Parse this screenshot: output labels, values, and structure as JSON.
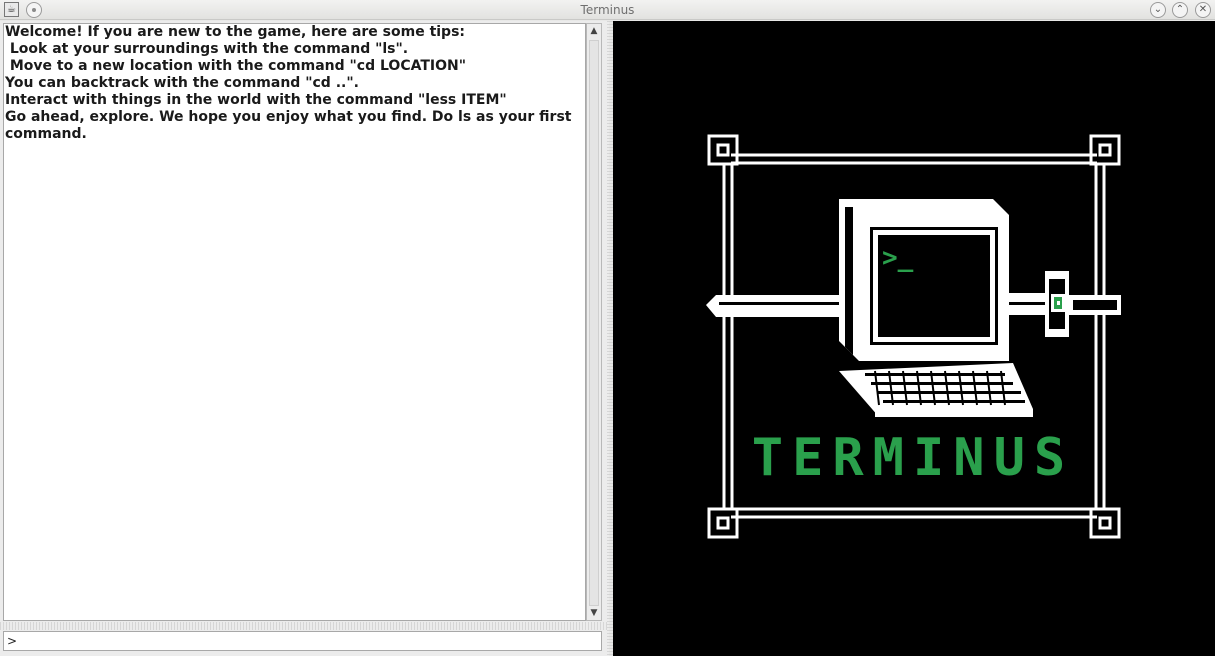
{
  "window": {
    "title": "Terminus",
    "controls": [
      "minimize",
      "maximize",
      "close"
    ]
  },
  "log": {
    "lines": [
      "Welcome! If you are new to the game, here are some tips:",
      " Look at your surroundings with the command \"ls\".",
      " Move to a new location with the command \"cd LOCATION\"",
      "You can backtrack with the command \"cd ..\".",
      "Interact with things in the world with the command \"less ITEM\"",
      "Go ahead, explore. We hope you enjoy what you find. Do ls as your first",
      "command."
    ]
  },
  "input": {
    "value": ">"
  },
  "logo": {
    "title": "TERMINUS",
    "screen_prompt": ">_",
    "accent_color": "#2aa04c"
  },
  "icons": {
    "app": "java-cup-icon",
    "pin": "pin-icon",
    "minimize": "chevron-down-icon",
    "maximize": "chevron-up-icon",
    "close": "close-icon",
    "scroll_up": "triangle-up-icon",
    "scroll_down": "triangle-down-icon"
  }
}
